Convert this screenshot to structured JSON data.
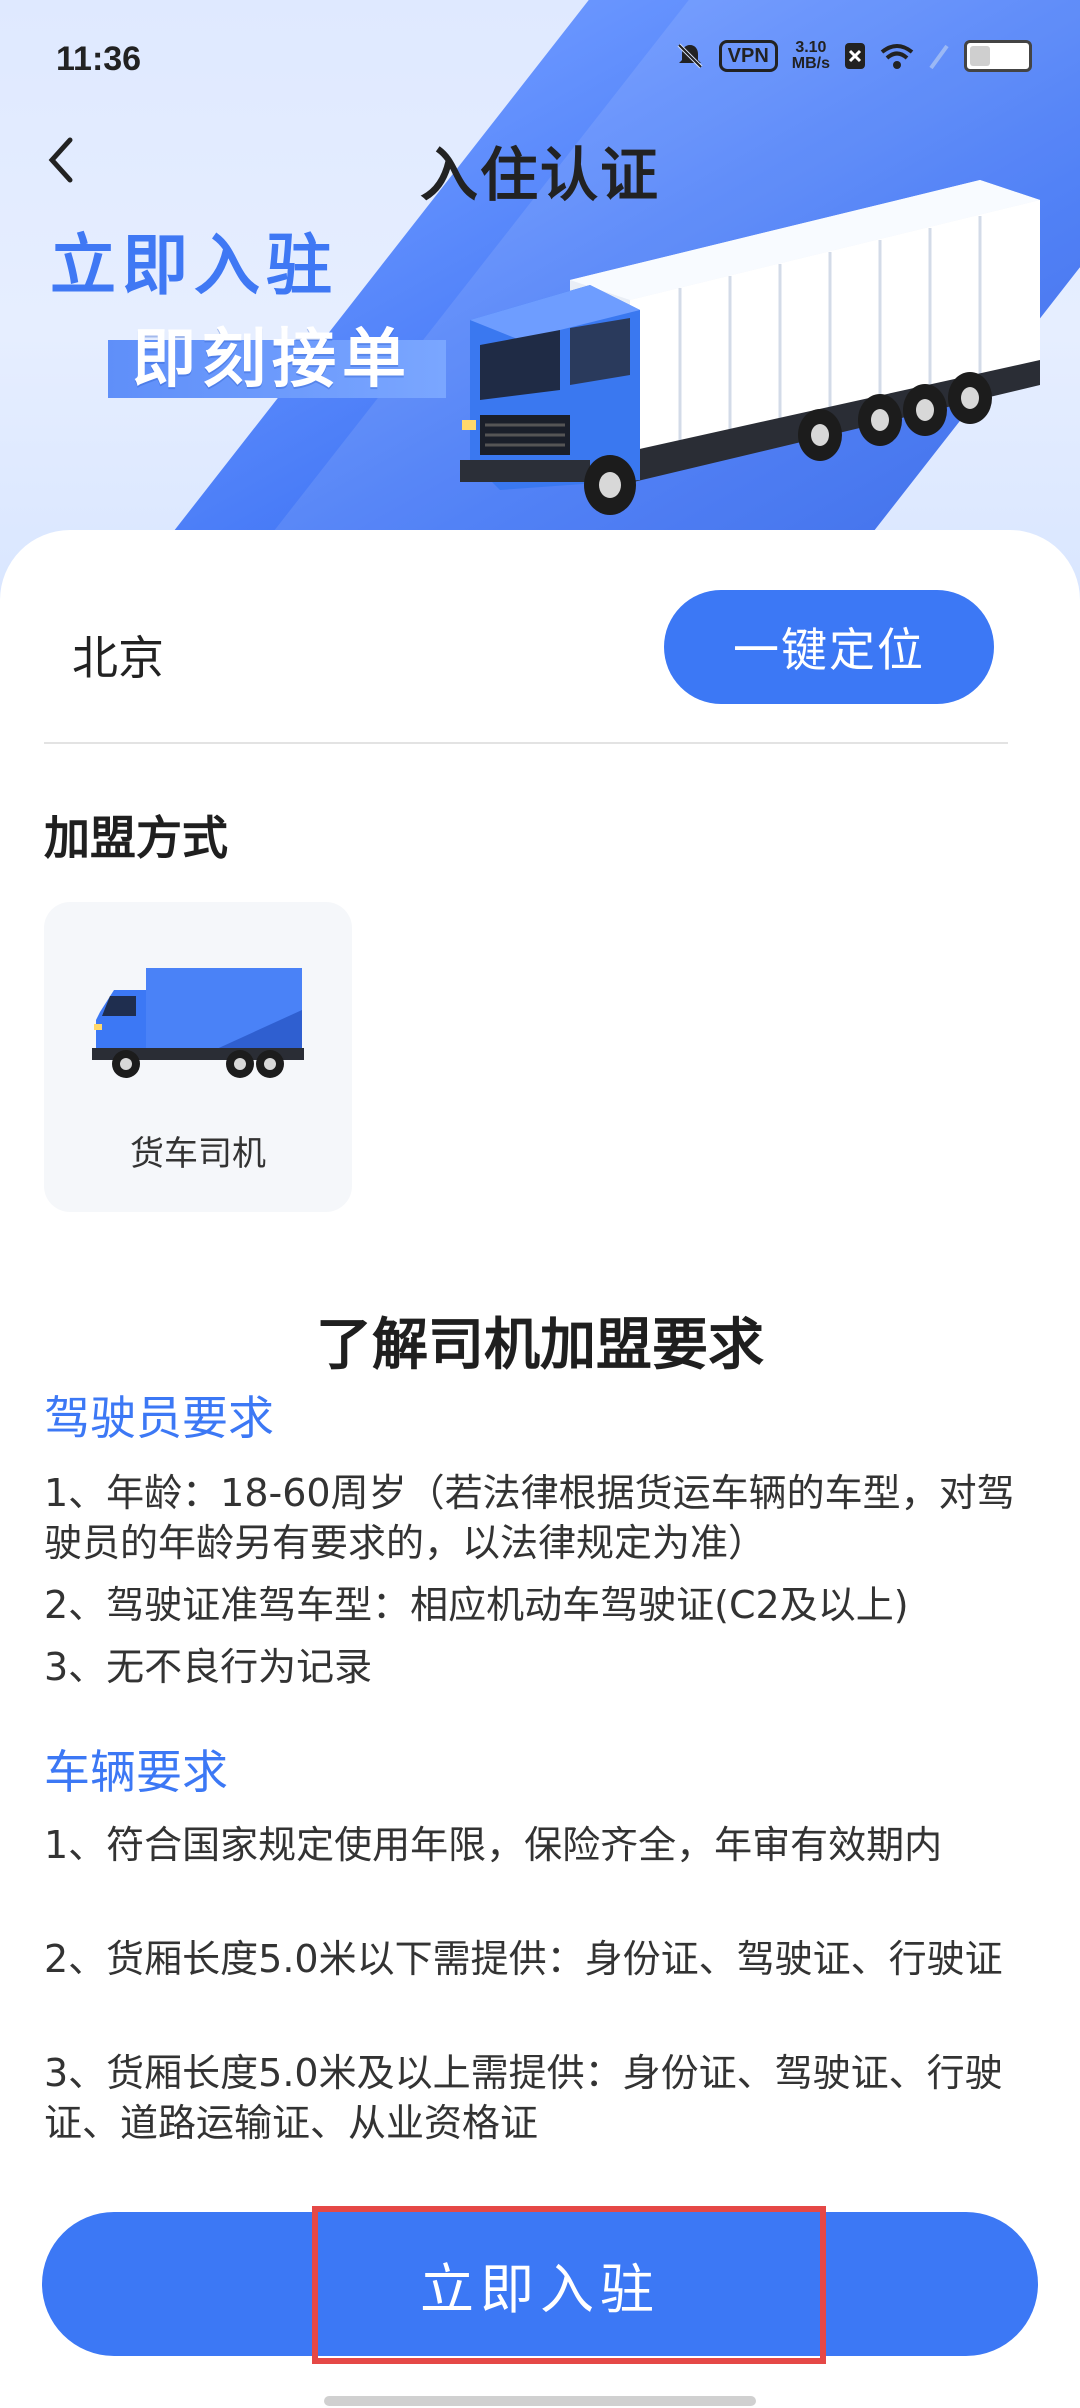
{
  "status_bar": {
    "time": "11:36",
    "vpn": "VPN",
    "speed_value": "3.10",
    "speed_unit": "MB/s"
  },
  "header": {
    "back_icon": "chevron-left-icon",
    "title": "入住认证"
  },
  "hero": {
    "slogan_primary": "立即入驻",
    "slogan_secondary": "即刻接单"
  },
  "location": {
    "city": "北京",
    "locate_button": "一键定位"
  },
  "join": {
    "section_title": "加盟方式",
    "options": [
      {
        "label": "货车司机",
        "icon": "truck-icon"
      }
    ]
  },
  "requirements": {
    "title": "了解司机加盟要求",
    "driver": {
      "heading": "驾驶员要求",
      "items": [
        "1、年龄：18-60周岁（若法律根据货运车辆的车型，对驾驶员的年龄另有要求的，以法律规定为准）",
        "2、驾驶证准驾车型：相应机动车驾驶证(C2及以上)",
        "3、无不良行为记录"
      ]
    },
    "vehicle": {
      "heading": "车辆要求",
      "items": [
        "1、符合国家规定使用年限，保险齐全，年审有效期内",
        "2、货厢长度5.0米以下需提供：身份证、驾驶证、行驶证",
        "3、货厢长度5.0米及以上需提供：身份证、驾驶证、行驶证、道路运输证、从业资格证"
      ]
    }
  },
  "submit": {
    "label": "立即入驻"
  },
  "colors": {
    "accent": "#3c78f5",
    "highlight": "#e54846"
  }
}
